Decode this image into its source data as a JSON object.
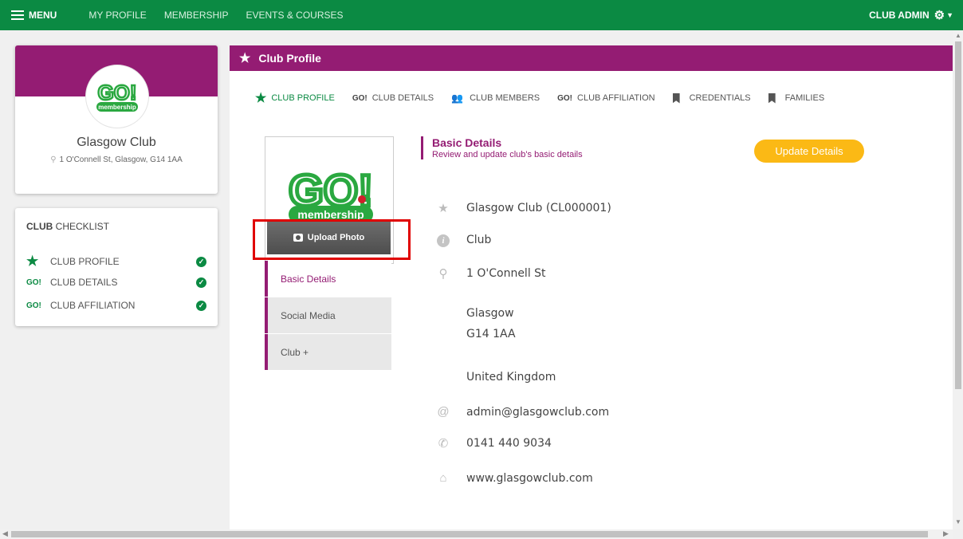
{
  "topnav": {
    "menu_label": "MENU",
    "links": [
      "MY PROFILE",
      "MEMBERSHIP",
      "EVENTS & COURSES"
    ],
    "admin_label": "CLUB ADMIN",
    "color": "#0b8a43"
  },
  "profile_card": {
    "logo_text": "GO!",
    "logo_sub": "membership",
    "name": "Glasgow Club",
    "address": "1 O'Connell St, Glasgow, G14 1AA"
  },
  "checklist": {
    "title_bold": "CLUB",
    "title_rest": " CHECKLIST",
    "items": [
      {
        "icon": "star-icon",
        "prefix": "★",
        "label": "CLUB PROFILE"
      },
      {
        "icon": "go-icon",
        "prefix": "GO!",
        "label": "CLUB DETAILS"
      },
      {
        "icon": "go-icon",
        "prefix": "GO!",
        "label": "CLUB AFFILIATION"
      }
    ]
  },
  "main": {
    "header_title": "Club Profile",
    "accent": "#941c73",
    "tabs": [
      {
        "prefix": "★",
        "label": "CLUB PROFILE"
      },
      {
        "prefix": "GO!",
        "label": "CLUB DETAILS"
      },
      {
        "prefix": "",
        "label": "CLUB MEMBERS"
      },
      {
        "prefix": "GO!",
        "label": "CLUB AFFILIATION"
      },
      {
        "prefix": "",
        "label": "CREDENTIALS"
      },
      {
        "prefix": "",
        "label": "FAMILIES"
      }
    ],
    "upload_label": "Upload Photo",
    "side_tabs": [
      "Basic Details",
      "Social Media",
      "Club +"
    ],
    "section_title": "Basic Details",
    "section_subtitle": "Review and update club's basic details",
    "update_label": "Update Details",
    "update_color": "#fbb915",
    "details": {
      "name": "Glasgow Club (CL000001)",
      "type": "Club",
      "street": "1 O'Connell St",
      "city": "Glasgow",
      "postcode": "G14 1AA",
      "country": "United Kingdom",
      "email": "admin@glasgowclub.com",
      "phone": "0141 440 9034",
      "website": "www.glasgowclub.com"
    }
  }
}
